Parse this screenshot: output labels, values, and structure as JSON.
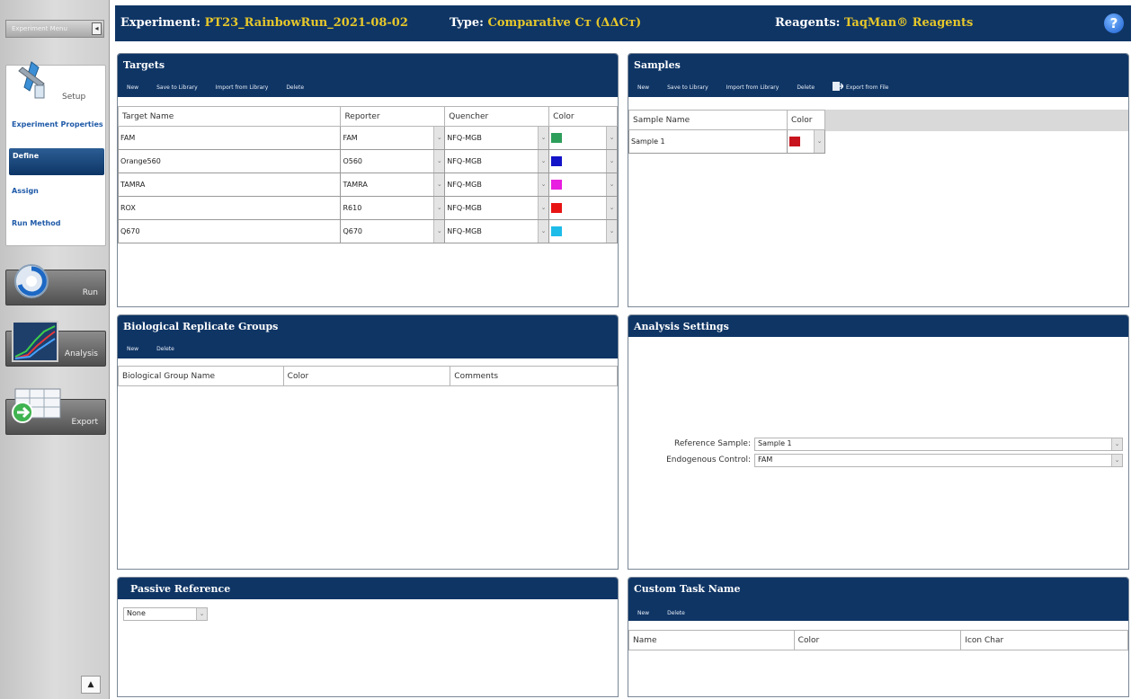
{
  "sidebar": {
    "header_label": "Experiment Menu",
    "collapse_glyph": "◂",
    "setup_label": "Setup",
    "setup_items": [
      {
        "label": "Experiment Properties",
        "active": false
      },
      {
        "label": "Define",
        "active": true
      },
      {
        "label": "Assign",
        "active": false
      },
      {
        "label": "Run Method",
        "active": false
      }
    ],
    "run_label": "Run",
    "analysis_label": "Analysis",
    "export_label": "Export",
    "scroll_glyph": "▲"
  },
  "header": {
    "experiment_key": "Experiment:",
    "experiment_value": "PT23_RainbowRun_2021-08-02",
    "type_key": "Type:",
    "type_value": "Comparative Cт (ΔΔCт)",
    "reagents_key": "Reagents:",
    "reagents_value": "TaqMan® Reagents",
    "help_glyph": "?"
  },
  "targets": {
    "title": "Targets",
    "toolbar": [
      "New",
      "Save to Library",
      "Import from Library",
      "Delete"
    ],
    "columns": [
      "Target Name",
      "Reporter",
      "Quencher",
      "Color"
    ],
    "rows": [
      {
        "name": "FAM",
        "reporter": "FAM",
        "quencher": "NFQ-MGB",
        "color": "#2e9e5b"
      },
      {
        "name": "Orange560",
        "reporter": "O560",
        "quencher": "NFQ-MGB",
        "color": "#1414c8"
      },
      {
        "name": "TAMRA",
        "reporter": "TAMRA",
        "quencher": "NFQ-MGB",
        "color": "#e81ee0"
      },
      {
        "name": "ROX",
        "reporter": "R610",
        "quencher": "NFQ-MGB",
        "color": "#e81414"
      },
      {
        "name": "Q670",
        "reporter": "Q670",
        "quencher": "NFQ-MGB",
        "color": "#1ebce8"
      }
    ]
  },
  "samples": {
    "title": "Samples",
    "toolbar": [
      "New",
      "Save to Library",
      "Import from Library",
      "Delete",
      "Export from File"
    ],
    "columns": [
      "Sample Name",
      "Color"
    ],
    "rows": [
      {
        "name": "Sample 1",
        "color": "#c8141e"
      }
    ]
  },
  "bio_groups": {
    "title": "Biological Replicate Groups",
    "toolbar": [
      "New",
      "Delete"
    ],
    "columns": [
      "Biological Group Name",
      "Color",
      "Comments"
    ]
  },
  "analysis": {
    "title": "Analysis Settings",
    "reference_sample_label": "Reference Sample:",
    "reference_sample_value": "Sample 1",
    "endogenous_control_label": "Endogenous Control:",
    "endogenous_control_value": "FAM"
  },
  "passive": {
    "title": "Passive Reference",
    "value": "None"
  },
  "custom_task": {
    "title": "Custom Task Name",
    "toolbar": [
      "New",
      "Delete"
    ],
    "columns": [
      "Name",
      "Color",
      "Icon Char"
    ]
  },
  "colors": {
    "brand_navy": "#0f3565",
    "header_value_yellow": "#e6c72b",
    "link_blue": "#1f5aa8"
  },
  "icons": [
    "setup-pipette-icon",
    "run-icon",
    "analysis-chart-icon",
    "export-icon",
    "help-icon",
    "export-file-icon"
  ]
}
